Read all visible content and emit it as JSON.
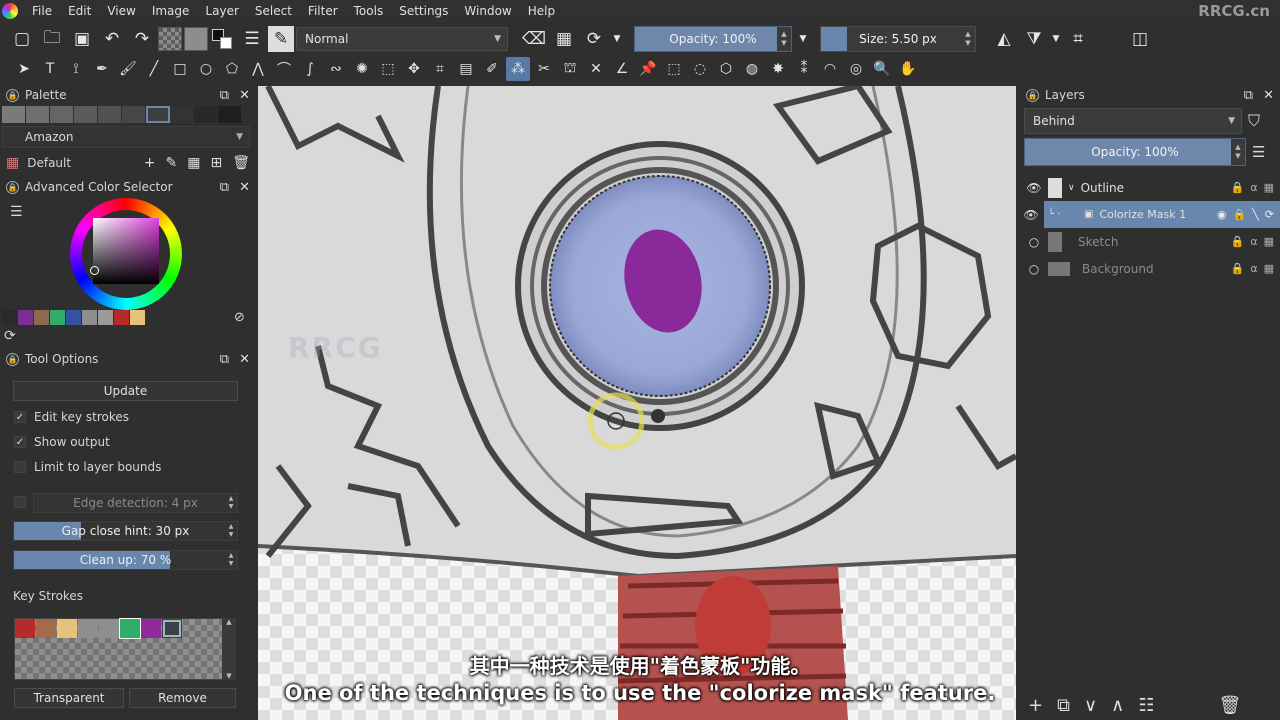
{
  "menu": {
    "items": [
      "File",
      "Edit",
      "View",
      "Image",
      "Layer",
      "Select",
      "Filter",
      "Tools",
      "Settings",
      "Window",
      "Help"
    ],
    "watermark": "RRCG.cn"
  },
  "toolbar": {
    "blend_mode": "Normal",
    "opacity": "Opacity: 100%",
    "size": "Size: 5.50 px"
  },
  "palette": {
    "title": "Palette",
    "library": "Amazon",
    "set": "Default",
    "swatches": [
      "#7a7a7a",
      "#6f6f6f",
      "#656565",
      "#5b5b5b",
      "#515151",
      "#474747",
      "#3d3d3d",
      "#333333",
      "#292929",
      "#1f1f1f"
    ]
  },
  "color_selector": {
    "title": "Advanced Color Selector",
    "history": [
      "#2a2a2a",
      "#7a2f92",
      "#8c6a4a",
      "#2fae6a",
      "#3452a0",
      "#8f8f8f",
      "#9a9a9a",
      "#b52a2a",
      "#e8c27a"
    ]
  },
  "tool_options": {
    "title": "Tool Options",
    "update_label": "Update",
    "edit_key_strokes": "Edit key strokes",
    "show_output": "Show output",
    "limit_bounds": "Limit to layer bounds",
    "edge_detection": "Edge detection: 4 px",
    "gap_close": "Gap close hint: 30 px",
    "gap_close_value": 0.3,
    "clean_up": "Clean up: 70 %",
    "clean_up_value": 0.7,
    "key_strokes_title": "Key Strokes",
    "key_stroke_colors": [
      "#b52a2a",
      "#a56a4a",
      "#e8c27a",
      "#8f8f8f",
      "#8f8f8f",
      "#2fae6a",
      "#8e2a9a",
      "#3a4048"
    ],
    "transparent_label": "Transparent",
    "remove_label": "Remove"
  },
  "layers": {
    "title": "Layers",
    "blend": "Behind",
    "opacity": "Opacity:  100%",
    "items": [
      {
        "name": "Outline"
      },
      {
        "name": "Colorize Mask 1"
      },
      {
        "name": "Sketch"
      },
      {
        "name": "Background"
      }
    ]
  },
  "subtitles": {
    "cn": "其中一种技术是使用\"着色蒙板\"功能。",
    "en": "One of the techniques is to use the \"colorize mask\" feature."
  },
  "overlay_watermark": "RRCG"
}
